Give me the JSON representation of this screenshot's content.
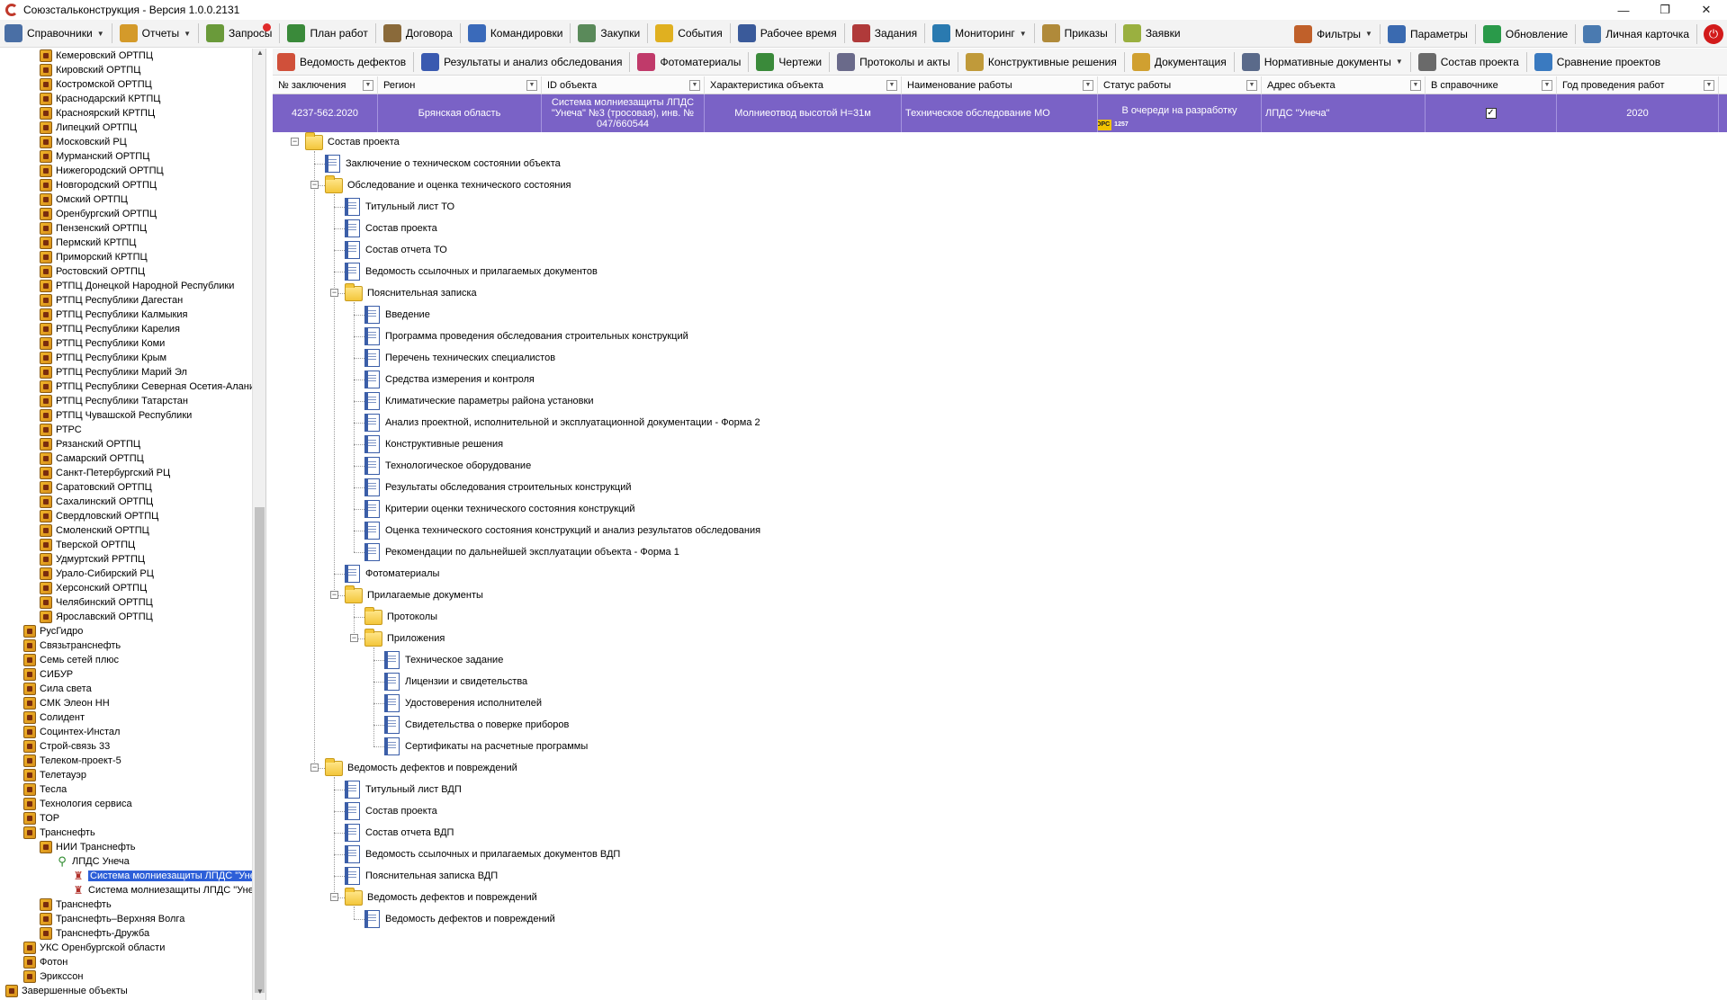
{
  "window": {
    "title": "Союзсталь­конструкция - Версия 1.0.0.2131",
    "minimize": "—",
    "restore": "❐",
    "close": "✕"
  },
  "toolbar": {
    "items": [
      {
        "label": "Справочники",
        "icon": "books-icon",
        "color": "#4a6fa5",
        "dropdown": true
      },
      {
        "label": "Отчеты",
        "icon": "reports-icon",
        "color": "#d49a2a",
        "dropdown": true
      },
      {
        "label": "Запросы",
        "icon": "requests-icon",
        "color": "#6a9a3a",
        "dropdown": false
      },
      {
        "label": "План работ",
        "icon": "plan-icon",
        "color": "#3a8a3a",
        "dropdown": false
      },
      {
        "label": "Договора",
        "icon": "contracts-icon",
        "color": "#8a6a3a",
        "dropdown": false
      },
      {
        "label": "Командировки",
        "icon": "trips-icon",
        "color": "#3a6aba",
        "dropdown": false
      },
      {
        "label": "Закупки",
        "icon": "purchases-icon",
        "color": "#5a8a5a",
        "dropdown": false
      },
      {
        "label": "События",
        "icon": "events-icon",
        "color": "#e0b020",
        "dropdown": false
      },
      {
        "label": "Рабочее время",
        "icon": "worktime-icon",
        "color": "#3a5a9a",
        "dropdown": false
      },
      {
        "label": "Задания",
        "icon": "tasks-icon",
        "color": "#b03a3a",
        "dropdown": false
      },
      {
        "label": "Мониторинг",
        "icon": "monitoring-icon",
        "color": "#2a7ab0",
        "dropdown": true
      },
      {
        "label": "Приказы",
        "icon": "orders-icon",
        "color": "#b08a3a",
        "dropdown": false
      },
      {
        "label": "Заявки",
        "icon": "applications-icon",
        "color": "#9ab040",
        "dropdown": false
      }
    ],
    "right_items": [
      {
        "label": "Фильтры",
        "icon": "filter-icon",
        "color": "#c0602a",
        "dropdown": true
      },
      {
        "label": "Параметры",
        "icon": "settings-icon",
        "color": "#3a6ab0",
        "dropdown": false
      },
      {
        "label": "Обновление",
        "icon": "update-icon",
        "color": "#2a9a4a",
        "dropdown": false
      },
      {
        "label": "Личная карточка",
        "icon": "profile-card-icon",
        "color": "#4a7ab0",
        "dropdown": false
      }
    ],
    "notification_badge": "!",
    "power_icon": "⏻"
  },
  "toolbar2": {
    "items": [
      {
        "label": "Ведомость дефектов",
        "icon": "defects-icon",
        "color": "#d0503a"
      },
      {
        "label": "Результаты и анализ обследования",
        "icon": "analysis-icon",
        "color": "#3a5ab0"
      },
      {
        "label": "Фотоматериалы",
        "icon": "photos-icon",
        "color": "#c03a6a"
      },
      {
        "label": "Чертежи",
        "icon": "drawings-icon",
        "color": "#3a8a3a"
      },
      {
        "label": "Протоколы и акты",
        "icon": "protocols-icon",
        "color": "#6a6a8a"
      },
      {
        "label": "Конструктивные решения",
        "icon": "constructive-icon",
        "color": "#c09a3a"
      },
      {
        "label": "Документация",
        "icon": "documentation-icon",
        "color": "#d0a030"
      },
      {
        "label": "Нормативные документы",
        "icon": "normative-icon",
        "color": "#5a6a8a",
        "dropdown": true
      },
      {
        "label": "Состав проекта",
        "icon": "project-composition-icon",
        "color": "#6a6a6a"
      },
      {
        "label": "Сравнение проектов",
        "icon": "compare-icon",
        "color": "#3a7ac0"
      }
    ]
  },
  "sidebar": {
    "items": [
      {
        "label": "Кемеровский ОРТПЦ",
        "level": 2,
        "icon": "folder"
      },
      {
        "label": "Кировский ОРТПЦ",
        "level": 2,
        "icon": "folder"
      },
      {
        "label": "Костромской ОРТПЦ",
        "level": 2,
        "icon": "folder"
      },
      {
        "label": "Краснодарский КРТПЦ",
        "level": 2,
        "icon": "folder"
      },
      {
        "label": "Красноярский КРТПЦ",
        "level": 2,
        "icon": "folder"
      },
      {
        "label": "Липецкий ОРТПЦ",
        "level": 2,
        "icon": "folder"
      },
      {
        "label": "Московский РЦ",
        "level": 2,
        "icon": "folder"
      },
      {
        "label": "Мурманский ОРТПЦ",
        "level": 2,
        "icon": "folder"
      },
      {
        "label": "Нижегородский ОРТПЦ",
        "level": 2,
        "icon": "folder"
      },
      {
        "label": "Новгородский ОРТПЦ",
        "level": 2,
        "icon": "folder"
      },
      {
        "label": "Омский ОРТПЦ",
        "level": 2,
        "icon": "folder"
      },
      {
        "label": "Оренбургский ОРТПЦ",
        "level": 2,
        "icon": "folder"
      },
      {
        "label": "Пензенский ОРТПЦ",
        "level": 2,
        "icon": "folder"
      },
      {
        "label": "Пермский КРТПЦ",
        "level": 2,
        "icon": "folder"
      },
      {
        "label": "Приморский КРТПЦ",
        "level": 2,
        "icon": "folder"
      },
      {
        "label": "Ростовский ОРТПЦ",
        "level": 2,
        "icon": "folder"
      },
      {
        "label": "РТПЦ Донецкой Народной Республики",
        "level": 2,
        "icon": "folder"
      },
      {
        "label": "РТПЦ Республики Дагестан",
        "level": 2,
        "icon": "folder"
      },
      {
        "label": "РТПЦ Республики Калмыкия",
        "level": 2,
        "icon": "folder"
      },
      {
        "label": "РТПЦ Республики Карелия",
        "level": 2,
        "icon": "folder"
      },
      {
        "label": "РТПЦ Республики Коми",
        "level": 2,
        "icon": "folder"
      },
      {
        "label": "РТПЦ Республики Крым",
        "level": 2,
        "icon": "folder"
      },
      {
        "label": "РТПЦ Республики Марий Эл",
        "level": 2,
        "icon": "folder"
      },
      {
        "label": "РТПЦ Республики Северная Осетия-Алания",
        "level": 2,
        "icon": "folder"
      },
      {
        "label": "РТПЦ Республики Татарстан",
        "level": 2,
        "icon": "folder"
      },
      {
        "label": "РТПЦ Чувашской Республики",
        "level": 2,
        "icon": "folder"
      },
      {
        "label": "РТРС",
        "level": 2,
        "icon": "folder"
      },
      {
        "label": "Рязанский ОРТПЦ",
        "level": 2,
        "icon": "folder"
      },
      {
        "label": "Самарский ОРТПЦ",
        "level": 2,
        "icon": "folder"
      },
      {
        "label": "Санкт-Петербургский РЦ",
        "level": 2,
        "icon": "folder"
      },
      {
        "label": "Саратовский ОРТПЦ",
        "level": 2,
        "icon": "folder"
      },
      {
        "label": "Сахалинский ОРТПЦ",
        "level": 2,
        "icon": "folder"
      },
      {
        "label": "Свердловский ОРТПЦ",
        "level": 2,
        "icon": "folder"
      },
      {
        "label": "Смоленский ОРТПЦ",
        "level": 2,
        "icon": "folder"
      },
      {
        "label": "Тверской ОРТПЦ",
        "level": 2,
        "icon": "folder"
      },
      {
        "label": "Удмуртский РРТПЦ",
        "level": 2,
        "icon": "folder"
      },
      {
        "label": "Урало-Сибирский РЦ",
        "level": 2,
        "icon": "folder"
      },
      {
        "label": "Херсонский ОРТПЦ",
        "level": 2,
        "icon": "folder"
      },
      {
        "label": "Челябинский ОРТПЦ",
        "level": 2,
        "icon": "folder"
      },
      {
        "label": "Ярославский ОРТПЦ",
        "level": 2,
        "icon": "folder"
      },
      {
        "label": "РусГидро",
        "level": 1,
        "icon": "folder"
      },
      {
        "label": "Связьтранснефть",
        "level": 1,
        "icon": "folder"
      },
      {
        "label": "Семь сетей плюс",
        "level": 1,
        "icon": "folder"
      },
      {
        "label": "СИБУР",
        "level": 1,
        "icon": "folder"
      },
      {
        "label": "Сила света",
        "level": 1,
        "icon": "folder"
      },
      {
        "label": "СМК Элеон НН",
        "level": 1,
        "icon": "folder"
      },
      {
        "label": "Солидент",
        "level": 1,
        "icon": "folder"
      },
      {
        "label": "Социнтех-Инстал",
        "level": 1,
        "icon": "folder"
      },
      {
        "label": "Строй-связь 33",
        "level": 1,
        "icon": "folder"
      },
      {
        "label": "Телеком-проект-5",
        "level": 1,
        "icon": "folder"
      },
      {
        "label": "Телетауэр",
        "level": 1,
        "icon": "folder"
      },
      {
        "label": "Тесла",
        "level": 1,
        "icon": "folder"
      },
      {
        "label": "Технология сервиса",
        "level": 1,
        "icon": "folder"
      },
      {
        "label": "ТОР",
        "level": 1,
        "icon": "folder"
      },
      {
        "label": "Транснефть",
        "level": 1,
        "icon": "folder"
      },
      {
        "label": "НИИ Транснефть",
        "level": 2,
        "icon": "folder"
      },
      {
        "label": "ЛПДС Унеча",
        "level": 3,
        "icon": "pin"
      },
      {
        "label": "Система молниезащиты ЛПДС \"Унеча\"",
        "level": 4,
        "icon": "tower",
        "selected": true
      },
      {
        "label": "Система молниезащиты ЛПДС \"Унеча\"",
        "level": 4,
        "icon": "tower"
      },
      {
        "label": "Транснефть",
        "level": 2,
        "icon": "folder"
      },
      {
        "label": "Транснефть–Верхняя Волга",
        "level": 2,
        "icon": "folder"
      },
      {
        "label": "Транснефть-Дружба",
        "level": 2,
        "icon": "folder"
      },
      {
        "label": "УКС Оренбургской области",
        "level": 1,
        "icon": "folder"
      },
      {
        "label": "Фотон",
        "level": 1,
        "icon": "folder"
      },
      {
        "label": "Эрикссон",
        "level": 1,
        "icon": "folder"
      },
      {
        "label": "Завершенные объекты",
        "level": 0,
        "icon": "folder"
      }
    ]
  },
  "grid": {
    "columns": [
      "№ заключения",
      "Регион",
      "ID объекта",
      "Характеристика объекта",
      "Наименование работы",
      "Статус работы",
      "Адрес объекта",
      "В справочнике",
      "Год проведения работ"
    ],
    "row": {
      "number": "4237-562.2020",
      "region": "Брянская область",
      "object_id": "Система молниезащиты ЛПДС \"Унеча\" №3 (тросовая), инв. № 047/660544",
      "characteristic": "Молниеотвод высотой Н=31м",
      "work_name": "Техническое обследование МО",
      "status": "В очереди на разработку",
      "status_tag": "OPC",
      "status_count": "1257",
      "address": "ЛПДС \"Унеча\"",
      "in_directory": "✓",
      "year": "2020"
    },
    "row_color": "#7a62c6"
  },
  "tree": {
    "nodes": [
      {
        "label": "Состав проекта",
        "level": 0,
        "type": "folder",
        "expanded": true
      },
      {
        "label": "Заключение о техническом состоянии объекта",
        "level": 1,
        "type": "doc"
      },
      {
        "label": "Обследование и оценка технического состояния",
        "level": 1,
        "type": "folder",
        "expanded": true
      },
      {
        "label": "Титульный лист ТО",
        "level": 2,
        "type": "doc"
      },
      {
        "label": "Состав проекта",
        "level": 2,
        "type": "doc"
      },
      {
        "label": "Состав отчета ТО",
        "level": 2,
        "type": "doc"
      },
      {
        "label": "Ведомость ссылочных и прилагаемых документов",
        "level": 2,
        "type": "doc"
      },
      {
        "label": "Пояснительная записка",
        "level": 2,
        "type": "folder",
        "expanded": true
      },
      {
        "label": "Введение",
        "level": 3,
        "type": "doc"
      },
      {
        "label": "Программа проведения обследования строительных конструкций",
        "level": 3,
        "type": "doc"
      },
      {
        "label": "Перечень технических специалистов",
        "level": 3,
        "type": "doc"
      },
      {
        "label": "Средства измерения и контроля",
        "level": 3,
        "type": "doc"
      },
      {
        "label": "Климатические параметры района установки",
        "level": 3,
        "type": "doc"
      },
      {
        "label": "Анализ проектной, исполнительной и эксплуатационной документации - Форма 2",
        "level": 3,
        "type": "doc"
      },
      {
        "label": "Конструктивные решения",
        "level": 3,
        "type": "doc"
      },
      {
        "label": "Технологическое оборудование",
        "level": 3,
        "type": "doc"
      },
      {
        "label": "Результаты обследования строительных конструкций",
        "level": 3,
        "type": "doc"
      },
      {
        "label": "Критерии оценки технического состояния конструкций",
        "level": 3,
        "type": "doc"
      },
      {
        "label": "Оценка технического состояния конструкций и анализ результатов обследования",
        "level": 3,
        "type": "doc"
      },
      {
        "label": "Рекомендации по дальнейшей эксплуатации объекта - Форма 1",
        "level": 3,
        "type": "doc"
      },
      {
        "label": "Фотоматериалы",
        "level": 2,
        "type": "doc"
      },
      {
        "label": "Прилагаемые документы",
        "level": 2,
        "type": "folder",
        "expanded": true
      },
      {
        "label": "Протоколы",
        "level": 3,
        "type": "folder"
      },
      {
        "label": "Приложения",
        "level": 3,
        "type": "folder",
        "expanded": true
      },
      {
        "label": "Техническое задание",
        "level": 4,
        "type": "doc"
      },
      {
        "label": "Лицензии и свидетельства",
        "level": 4,
        "type": "doc"
      },
      {
        "label": "Удостоверения исполнителей",
        "level": 4,
        "type": "doc"
      },
      {
        "label": "Свидетельства о поверке приборов",
        "level": 4,
        "type": "doc"
      },
      {
        "label": "Сертификаты на расчетные программы",
        "level": 4,
        "type": "doc"
      },
      {
        "label": "Ведомость дефектов и повреждений",
        "level": 1,
        "type": "folder",
        "expanded": true
      },
      {
        "label": "Титульный лист ВДП",
        "level": 2,
        "type": "doc"
      },
      {
        "label": "Состав проекта",
        "level": 2,
        "type": "doc"
      },
      {
        "label": "Состав отчета ВДП",
        "level": 2,
        "type": "doc"
      },
      {
        "label": "Ведомость ссылочных и прилагаемых документов ВДП",
        "level": 2,
        "type": "doc"
      },
      {
        "label": "Пояснительная записка ВДП",
        "level": 2,
        "type": "doc"
      },
      {
        "label": "Ведомость дефектов и повреждений",
        "level": 2,
        "type": "folder",
        "expanded": true
      },
      {
        "label": "Ведомость дефектов и повреждений",
        "level": 3,
        "type": "doc"
      }
    ]
  }
}
